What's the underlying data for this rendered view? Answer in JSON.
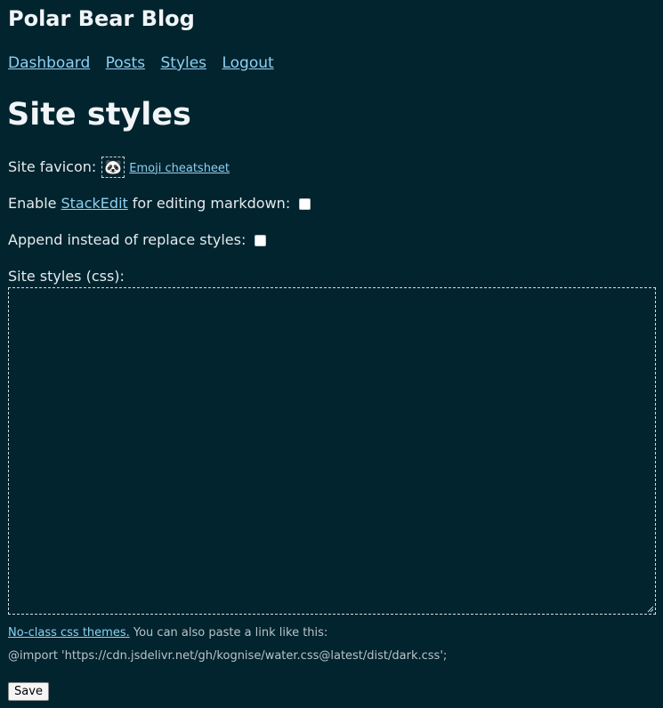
{
  "header": {
    "site_title": "Polar Bear Blog"
  },
  "nav": {
    "items": [
      {
        "label": "Dashboard"
      },
      {
        "label": "Posts"
      },
      {
        "label": "Styles"
      },
      {
        "label": "Logout"
      }
    ]
  },
  "main": {
    "title": "Site styles",
    "favicon": {
      "label": "Site favicon:",
      "value": "🐼",
      "cheatsheet_link": "Emoji cheatsheet"
    },
    "stackedit": {
      "prefix": "Enable",
      "link": "StackEdit",
      "suffix": "for editing markdown:",
      "checked": false
    },
    "append": {
      "label": "Append instead of replace styles:",
      "checked": false
    },
    "css": {
      "label": "Site styles (css):",
      "value": ""
    },
    "hint": {
      "link": "No-class css themes.",
      "text": "You can also paste a link like this:",
      "example": "@import 'https://cdn.jsdelivr.net/gh/kognise/water.css@latest/dist/dark.css';"
    },
    "save_label": "Save"
  },
  "colors": {
    "background": "#01242e",
    "link": "#8fd0f2",
    "text": "#e6ebef"
  }
}
